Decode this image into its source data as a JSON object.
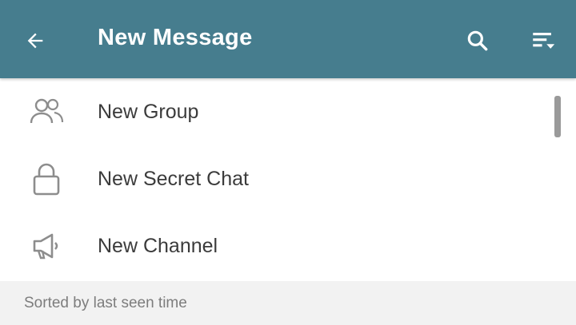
{
  "header": {
    "title": "New Message",
    "back_icon": "arrow-left-icon",
    "search_icon": "search-icon",
    "sort_icon": "sort-icon",
    "background_color": "#467d8e",
    "text_color": "#ffffff"
  },
  "actions": [
    {
      "label": "New Group",
      "icon": "group-icon"
    },
    {
      "label": "New Secret Chat",
      "icon": "lock-icon"
    },
    {
      "label": "New Channel",
      "icon": "megaphone-icon"
    }
  ],
  "section": {
    "label": "Sorted by last seen time"
  }
}
